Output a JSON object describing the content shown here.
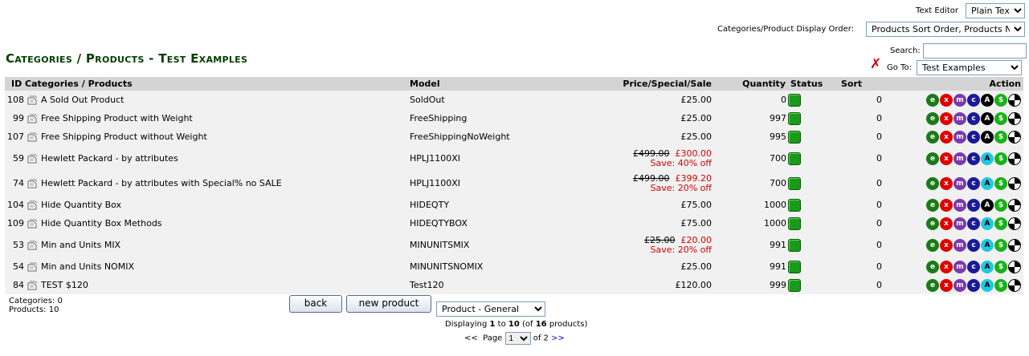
{
  "header": {
    "text_editor_label": "Text Editor",
    "text_editor_value": "Plain Text",
    "display_order_label": "Categories/Product Display Order:",
    "display_order_value": "Products Sort Order, Products Name",
    "page_title": "Categories / Products - Test Examples",
    "search_label": "Search:",
    "search_value": "",
    "goto_label": "Go To:",
    "goto_value": "Test Examples"
  },
  "columns": {
    "id_categories": "ID Categories / Products",
    "model": "Model",
    "price": "Price/Special/Sale",
    "quantity": "Quantity",
    "status": "Status",
    "sort": "Sort",
    "action": "Action"
  },
  "rows": [
    {
      "id": "108",
      "name": "A Sold Out Product",
      "model": "SoldOut",
      "price": "£25.00",
      "old_price": "",
      "special": "",
      "save": "",
      "qty": "0",
      "sort": "0",
      "a_style": "black"
    },
    {
      "id": "99",
      "name": "Free Shipping Product with Weight",
      "model": "FreeShipping",
      "price": "£25.00",
      "old_price": "",
      "special": "",
      "save": "",
      "qty": "997",
      "sort": "0",
      "a_style": "black"
    },
    {
      "id": "107",
      "name": "Free Shipping Product without Weight",
      "model": "FreeShippingNoWeight",
      "price": "£25.00",
      "old_price": "",
      "special": "",
      "save": "",
      "qty": "995",
      "sort": "0",
      "a_style": "black"
    },
    {
      "id": "59",
      "name": "Hewlett Packard - by attributes",
      "model": "HPLJ1100XI",
      "price": "",
      "old_price": "£499.00",
      "special": "£300.00",
      "save": "Save: 40% off",
      "qty": "700",
      "sort": "0",
      "a_style": "cyan"
    },
    {
      "id": "74",
      "name": "Hewlett Packard - by attributes with Special% no SALE",
      "model": "HPLJ1100XI",
      "price": "",
      "old_price": "£499.00",
      "special": "£399.20",
      "save": "Save: 20% off",
      "qty": "700",
      "sort": "0",
      "a_style": "cyan"
    },
    {
      "id": "104",
      "name": "Hide Quantity Box",
      "model": "HIDEQTY",
      "price": "£75.00",
      "old_price": "",
      "special": "",
      "save": "",
      "qty": "1000",
      "sort": "0",
      "a_style": "black"
    },
    {
      "id": "109",
      "name": "Hide Quantity Box Methods",
      "model": "HIDEQTYBOX",
      "price": "£75.00",
      "old_price": "",
      "special": "",
      "save": "",
      "qty": "1000",
      "sort": "0",
      "a_style": "cyan"
    },
    {
      "id": "53",
      "name": "Min and Units MIX",
      "model": "MINUNITSMIX",
      "price": "",
      "old_price": "£25.00",
      "special": "£20.00",
      "save": "Save: 20% off",
      "qty": "991",
      "sort": "0",
      "a_style": "cyan"
    },
    {
      "id": "54",
      "name": "Min and Units NOMIX",
      "model": "MINUNITSNOMIX",
      "price": "£25.00",
      "old_price": "",
      "special": "",
      "save": "",
      "qty": "991",
      "sort": "0",
      "a_style": "cyan"
    },
    {
      "id": "84",
      "name": "TEST $120",
      "model": "Test120",
      "price": "£120.00",
      "old_price": "",
      "special": "",
      "save": "",
      "qty": "999",
      "sort": "0",
      "a_style": "cyan"
    }
  ],
  "action_icons": {
    "edit": "e",
    "delete": "x",
    "move": "m",
    "copy": "c",
    "attributes": "A",
    "dollar": "$",
    "preview": "⊕"
  },
  "footer": {
    "categories_count": "Categories: 0",
    "products_count": "Products: 10",
    "back_label": "back",
    "new_product_label": "new product",
    "product_type_value": "Product - General",
    "displaying_prefix": "Displaying ",
    "from": "1",
    "to_word": " to ",
    "to": "10",
    "of_prefix": " (of ",
    "total": "16",
    "of_suffix": " products)",
    "prev": "<<",
    "page_label": "Page",
    "page_value": "1",
    "of_pages": "of 2",
    "next": ">>"
  }
}
